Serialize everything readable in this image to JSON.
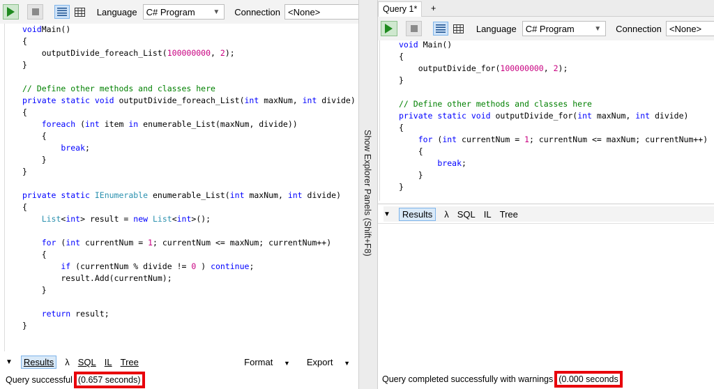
{
  "toolbar": {
    "language_label": "Language",
    "language_value": "C# Program",
    "connection_label": "Connection",
    "connection_value": "<None>"
  },
  "left": {
    "code": [
      [
        [
          "kw",
          "void"
        ],
        [
          "",
          "Main()"
        ]
      ],
      [
        [
          "",
          "{"
        ]
      ],
      [
        [
          "",
          "    outputDivide_foreach_List("
        ],
        [
          "num",
          "100000000"
        ],
        [
          "",
          ", "
        ],
        [
          "num",
          "2"
        ],
        [
          "",
          ");"
        ]
      ],
      [
        [
          "",
          "}"
        ]
      ],
      [
        [
          "",
          ""
        ]
      ],
      [
        [
          "cm",
          "// Define other methods and classes here"
        ]
      ],
      [
        [
          "kw",
          "private static void"
        ],
        [
          "",
          " outputDivide_foreach_List("
        ],
        [
          "kw",
          "int"
        ],
        [
          "",
          " maxNum, "
        ],
        [
          "kw",
          "int"
        ],
        [
          "",
          " divide)"
        ]
      ],
      [
        [
          "",
          "{"
        ]
      ],
      [
        [
          "kw",
          "    foreach"
        ],
        [
          "",
          " ("
        ],
        [
          "kw",
          "int"
        ],
        [
          "",
          " item "
        ],
        [
          "kw",
          "in"
        ],
        [
          "",
          " enumerable_List(maxNum, divide))"
        ]
      ],
      [
        [
          "",
          "    {"
        ]
      ],
      [
        [
          "kw",
          "        break"
        ],
        [
          "",
          ";"
        ]
      ],
      [
        [
          "",
          "    }"
        ]
      ],
      [
        [
          "",
          "}"
        ]
      ],
      [
        [
          "",
          ""
        ]
      ],
      [
        [
          "kw",
          "private static"
        ],
        [
          "ty",
          " IEnumerable"
        ],
        [
          "",
          " enumerable_List("
        ],
        [
          "kw",
          "int"
        ],
        [
          "",
          " maxNum, "
        ],
        [
          "kw",
          "int"
        ],
        [
          "",
          " divide)"
        ]
      ],
      [
        [
          "",
          "{"
        ]
      ],
      [
        [
          "ty",
          "    List"
        ],
        [
          "",
          "<"
        ],
        [
          "kw",
          "int"
        ],
        [
          "",
          "> result = "
        ],
        [
          "kw",
          "new"
        ],
        [
          "ty",
          " List"
        ],
        [
          "",
          "<"
        ],
        [
          "kw",
          "int"
        ],
        [
          "",
          ">();"
        ]
      ],
      [
        [
          "",
          ""
        ]
      ],
      [
        [
          "kw",
          "    for"
        ],
        [
          "",
          " ("
        ],
        [
          "kw",
          "int"
        ],
        [
          "",
          " currentNum = "
        ],
        [
          "num",
          "1"
        ],
        [
          "",
          "; currentNum <= maxNum; currentNum++)"
        ]
      ],
      [
        [
          "",
          "    {"
        ]
      ],
      [
        [
          "kw",
          "        if"
        ],
        [
          "",
          " (currentNum % divide != "
        ],
        [
          "num",
          "0"
        ],
        [
          "",
          " ) "
        ],
        [
          "kw",
          "continue"
        ],
        [
          "",
          ";"
        ]
      ],
      [
        [
          "",
          "        result.Add(currentNum);"
        ]
      ],
      [
        [
          "",
          "    }"
        ]
      ],
      [
        [
          "",
          ""
        ]
      ],
      [
        [
          "kw",
          "    return"
        ],
        [
          "",
          " result;"
        ]
      ],
      [
        [
          "",
          "}"
        ]
      ]
    ],
    "results_tabs": [
      "Results",
      "λ",
      "SQL",
      "IL",
      "Tree"
    ],
    "format_label": "Format",
    "export_label": "Export",
    "status_text": "Query successful",
    "status_time": "(0.657 seconds)"
  },
  "divider": {
    "label": "Show Explorer Panels (Shift+F8)"
  },
  "right": {
    "tabs": [
      "Query 1*",
      "+"
    ],
    "code": [
      [
        [
          "kw",
          "void"
        ],
        [
          "",
          " Main()"
        ]
      ],
      [
        [
          "",
          "{"
        ]
      ],
      [
        [
          "",
          "    outputDivide_for("
        ],
        [
          "num",
          "100000000"
        ],
        [
          "",
          ", "
        ],
        [
          "num",
          "2"
        ],
        [
          "",
          ");"
        ]
      ],
      [
        [
          "",
          "}"
        ]
      ],
      [
        [
          "",
          ""
        ]
      ],
      [
        [
          "cm",
          "// Define other methods and classes here"
        ]
      ],
      [
        [
          "kw",
          "private static void"
        ],
        [
          "",
          " outputDivide_for("
        ],
        [
          "kw",
          "int"
        ],
        [
          "",
          " maxNum, "
        ],
        [
          "kw",
          "int"
        ],
        [
          "",
          " divide)"
        ]
      ],
      [
        [
          "",
          "{"
        ]
      ],
      [
        [
          "kw",
          "    for"
        ],
        [
          "",
          " ("
        ],
        [
          "kw",
          "int"
        ],
        [
          "",
          " currentNum = "
        ],
        [
          "num",
          "1"
        ],
        [
          "",
          "; currentNum <= maxNum; currentNum++)"
        ]
      ],
      [
        [
          "",
          "    {"
        ]
      ],
      [
        [
          "kw",
          "        break"
        ],
        [
          "",
          ";"
        ]
      ],
      [
        [
          "",
          "    }"
        ]
      ],
      [
        [
          "",
          "}"
        ]
      ]
    ],
    "results_tabs": [
      "Results",
      "λ",
      "SQL",
      "IL",
      "Tree"
    ],
    "status_text": "Query completed successfully with warnings",
    "status_time": "(0.000 seconds"
  }
}
